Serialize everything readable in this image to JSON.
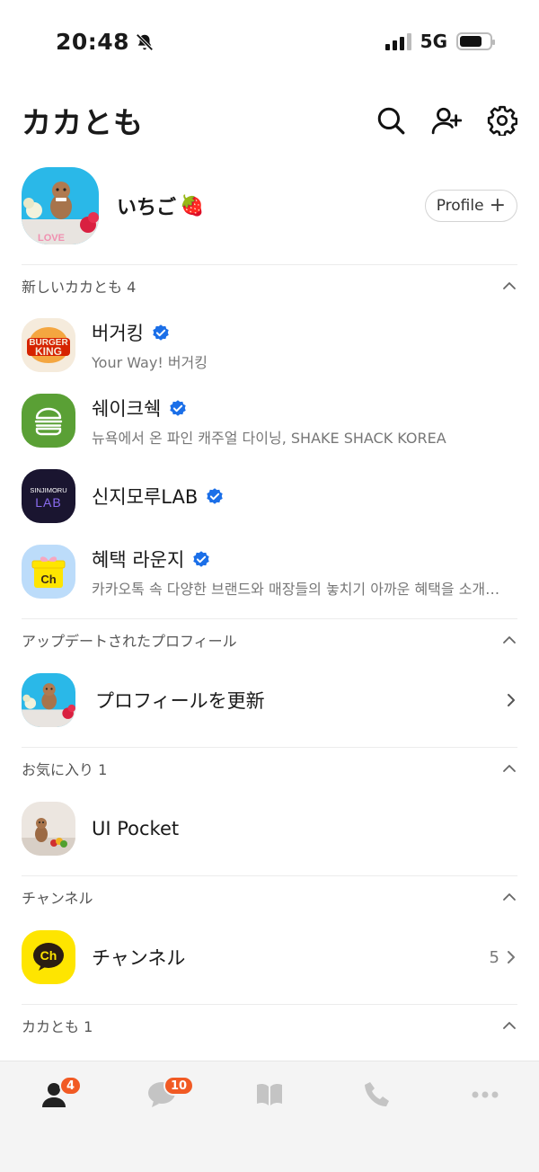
{
  "status": {
    "time": "20:48",
    "network": "5G",
    "battery_level": 0.75
  },
  "header": {
    "title": "カカとも"
  },
  "my_profile": {
    "name": "いちご",
    "emoji": "🍓",
    "profile_button": "Profile",
    "profile_button_icon": "+"
  },
  "sections": {
    "new_friends": {
      "title": "新しいカカとも 4",
      "items": [
        {
          "name": "버거킹",
          "subtitle": "Your Way! 버거킹",
          "logo_text": [
            "BURGER",
            "KING"
          ],
          "verified": true
        },
        {
          "name": "쉐이크쉑",
          "subtitle": "뉴욕에서 온 파인 캐주얼 다이닝, SHAKE SHACK KOREA",
          "verified": true
        },
        {
          "name": "신지모루LAB",
          "subtitle": "",
          "logo_text": [
            "SINJIMORU",
            "LAB"
          ],
          "verified": true
        },
        {
          "name": "혜택 라운지",
          "subtitle": "카카오톡 속 다양한 브랜드와 매장들의 놓치기 아까운 혜택을 소개…",
          "logo_text": [
            "Ch"
          ],
          "verified": true
        }
      ]
    },
    "updated_profiles": {
      "title": "アップデートされたプロフィール",
      "item_label": "プロフィールを更新"
    },
    "favorites": {
      "title": "お気に入り 1",
      "items": [
        {
          "name": "UI Pocket"
        }
      ]
    },
    "channels": {
      "title": "チャンネル",
      "item_label": "チャンネル",
      "logo_text": "Ch",
      "count": "5"
    },
    "friends": {
      "title": "カカとも 1"
    }
  },
  "tab_bar": {
    "friends_badge": "4",
    "chats_badge": "10"
  },
  "colors": {
    "kakao_yellow": "#FEE500",
    "badge_orange": "#F15A24",
    "verified_blue": "#1B6FE8"
  }
}
